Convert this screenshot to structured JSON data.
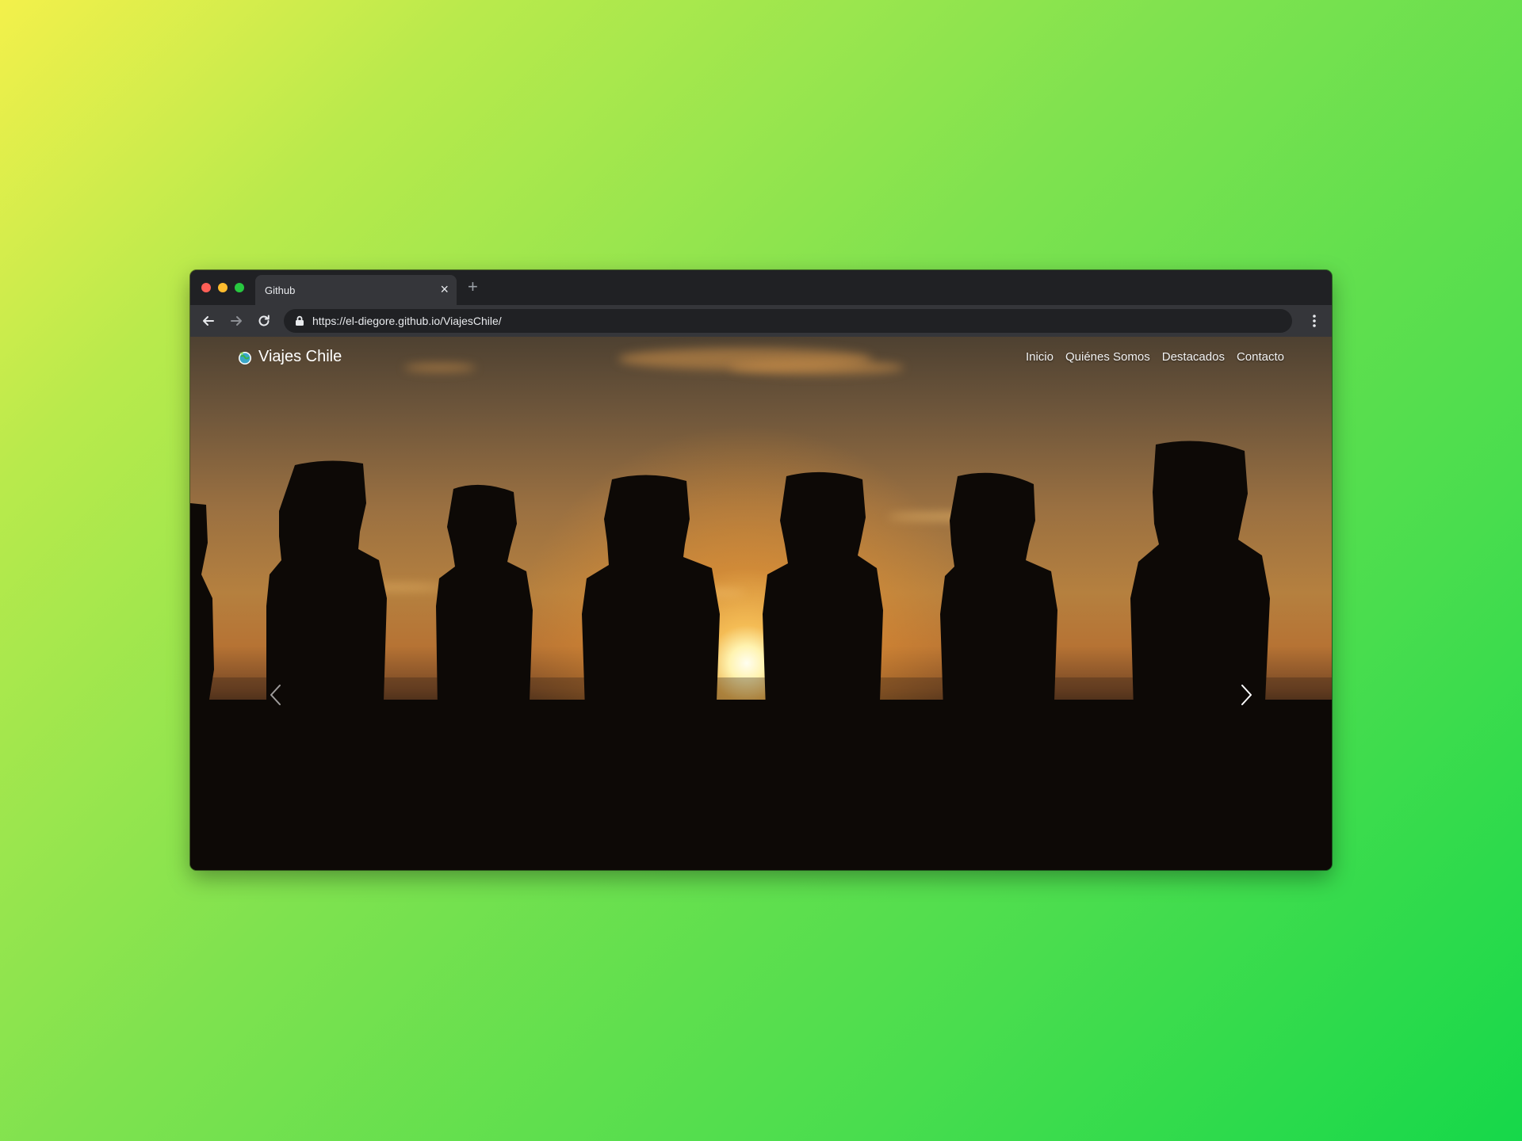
{
  "browser": {
    "tab_title": "Github",
    "url": "https://el-diegore.github.io/ViajesChile/",
    "close_icon": "close-icon",
    "new_tab_icon": "plus-icon"
  },
  "site": {
    "brand": "Viajes Chile",
    "brand_icon": "globe-logo-icon",
    "nav": [
      "Inicio",
      "Quiénes Somos",
      "Destacados",
      "Contacto"
    ]
  },
  "hero": {
    "image": "moai-sunset-photo",
    "prev_icon": "chevron-left-icon",
    "next_icon": "chevron-right-icon"
  },
  "colors": {
    "background_start": "#f3f04b",
    "background_end": "#16d84a",
    "chrome_dark": "#202124",
    "chrome_toolbar": "#35363a"
  }
}
